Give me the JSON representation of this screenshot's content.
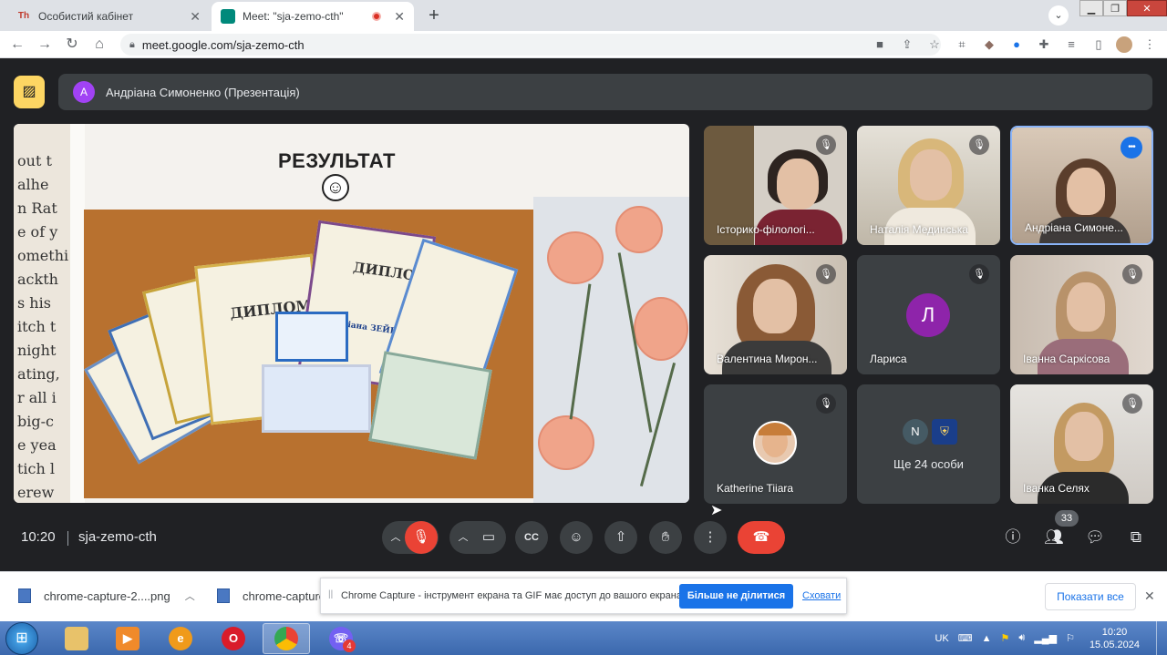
{
  "browser": {
    "tabs": [
      {
        "title": "Особистий кабінет",
        "favicon": "Th"
      },
      {
        "title": "Meet: \"sja-zemo-cth\"",
        "recording": true
      }
    ],
    "url": "meet.google.com/sja-zemo-cth"
  },
  "meet": {
    "presenter": {
      "initial": "А",
      "name": "Андріана Симоненко (Презентація)"
    },
    "slide": {
      "title": "РЕЗУЛЬТАТ",
      "paper_text": [
        "out t",
        "alhe",
        "n Rat",
        "e of y",
        "omethi",
        "ackth",
        "s his",
        "itch t",
        "night",
        "ating,",
        "r all i",
        "big-c",
        "e yea",
        "tich l",
        "erew"
      ],
      "photo_labels": {
        "diploma1": "ДИПЛОМ",
        "diploma2": "ДИПЛОМ",
        "name": "Андріана ЗЕЙКАН"
      }
    },
    "participants": [
      {
        "name": "Історико-філологі...",
        "muted": true
      },
      {
        "name": "Наталія Мединська",
        "muted": true
      },
      {
        "name": "Андріана Симоне...",
        "speaking": true
      },
      {
        "name": "Валентина Мирон...",
        "muted": true
      },
      {
        "name": "Лариса",
        "initial": "Л",
        "muted": true
      },
      {
        "name": "Іванна Саркісова",
        "muted": true
      },
      {
        "name": "Katherine Tiiara",
        "muted": true
      },
      {
        "name": "Ще 24 особи",
        "initial": "N"
      },
      {
        "name": "Іванка Селях",
        "muted": true
      }
    ],
    "time": "10:20",
    "meeting_code": "sja-zemo-cth",
    "people_count": "33"
  },
  "downloads": {
    "items": [
      "chrome-capture-2....png",
      "chrome-capture"
    ],
    "show_all": "Показати все"
  },
  "capture_notice": {
    "message": "Chrome Capture - інструмент екрана та GIF має доступ до вашого екрана.",
    "stop_label": "Більше не ділитися",
    "hide_label": "Сховати"
  },
  "taskbar": {
    "lang": "UK",
    "time": "10:20",
    "date": "15.05.2024",
    "viber_badge": "4"
  }
}
